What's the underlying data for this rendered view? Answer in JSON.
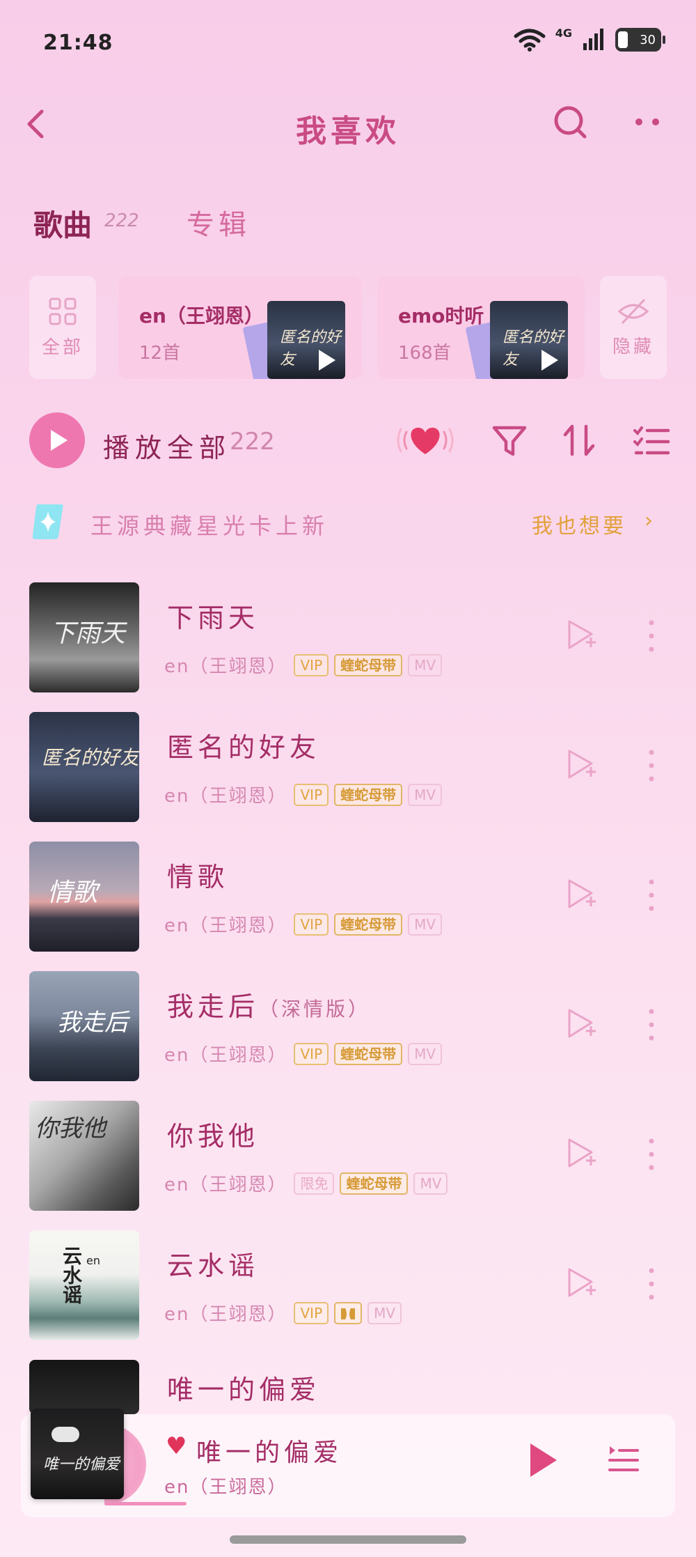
{
  "status_bar": {
    "time": "21:48",
    "network": "4G",
    "battery": "30"
  },
  "header": {
    "title": "我喜欢"
  },
  "tabs": [
    {
      "label": "歌曲",
      "count": "222"
    },
    {
      "label": "专辑"
    }
  ],
  "filter_cards": {
    "all_label": "全部",
    "hidden_label": "隐藏",
    "playlists": [
      {
        "name": "en（王翊恩）",
        "count": "12首",
        "cover_text": "匿名的好友"
      },
      {
        "name": "emo时听",
        "count": "168首",
        "cover_text": "匿名的好友"
      }
    ]
  },
  "play_all": {
    "label": "播放全部",
    "count": "222"
  },
  "promo": {
    "text": "王源典藏星光卡上新",
    "link": "我也想要",
    "chevron": "›"
  },
  "songs": [
    {
      "title": "下雨天",
      "subtitle": "",
      "artist": "en（王翊恩）",
      "tags": [
        "VIP",
        "蝰蛇母带",
        "MV"
      ],
      "cover_text": "下雨天"
    },
    {
      "title": "匿名的好友",
      "subtitle": "",
      "artist": "en（王翊恩）",
      "tags": [
        "VIP",
        "蝰蛇母带",
        "MV"
      ],
      "cover_text": "匿名的好友"
    },
    {
      "title": "情歌",
      "subtitle": "",
      "artist": "en（王翊恩）",
      "tags": [
        "VIP",
        "蝰蛇母带",
        "MV"
      ],
      "cover_text": "情歌"
    },
    {
      "title": "我走后",
      "subtitle": "（深情版）",
      "artist": "en（王翊恩）",
      "tags": [
        "VIP",
        "蝰蛇母带",
        "MV"
      ],
      "cover_text": "我走后"
    },
    {
      "title": "你我他",
      "subtitle": "",
      "artist": "en（王翊恩）",
      "tags": [
        "限免",
        "蝰蛇母带",
        "MV"
      ],
      "cover_text": "你我他"
    },
    {
      "title": "云水谣",
      "subtitle": "",
      "artist": "en（王翊恩）",
      "tags": [
        "VIP",
        "MV"
      ],
      "cover_text": "云水谣",
      "cover_badge": "en"
    },
    {
      "title": "唯一的偏爱",
      "subtitle": "",
      "artist": "",
      "tags": [],
      "cover_text": ""
    }
  ],
  "mini_player": {
    "title": "唯一的偏爱",
    "artist": "en（王翊恩）",
    "cover_text": "唯一的偏爱",
    "progress": 0.15
  },
  "colors": {
    "accent": "#ef77b0",
    "title": "#a42d66",
    "gold": "#e2a13c",
    "heart": "#e0345b"
  }
}
